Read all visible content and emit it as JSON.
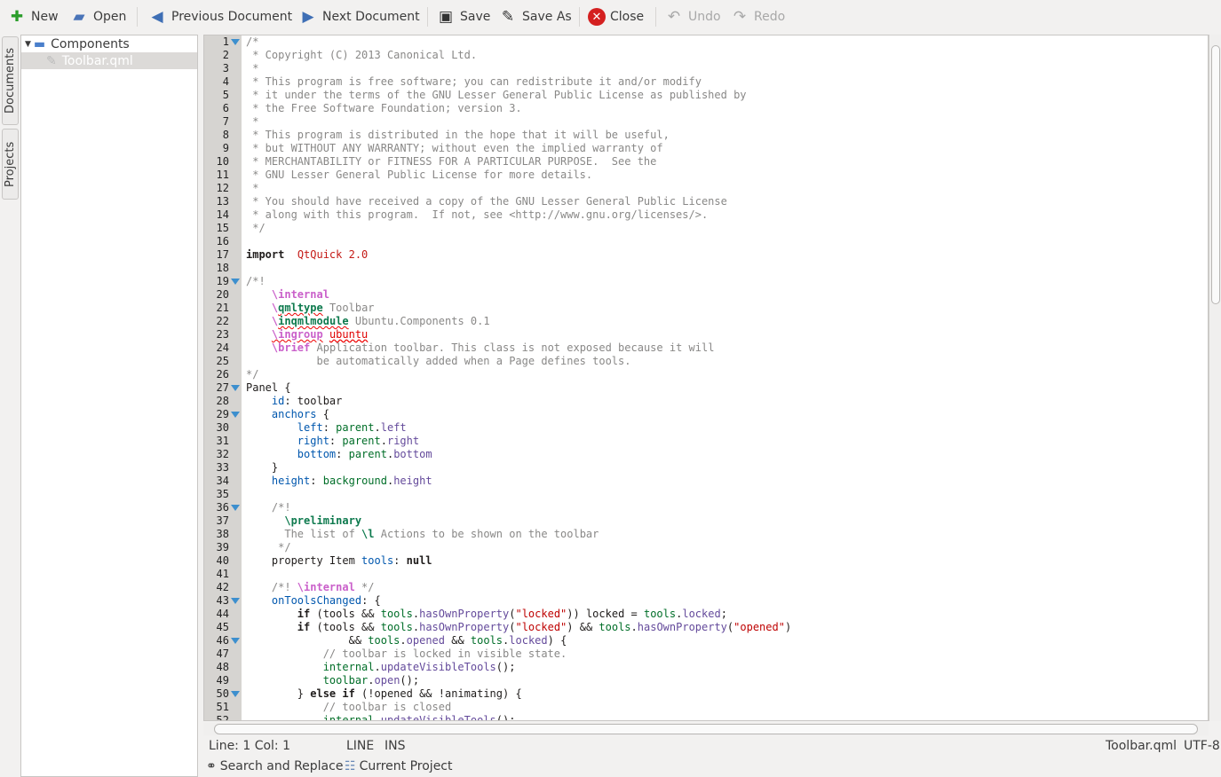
{
  "toolbar": {
    "items": [
      {
        "label": "New",
        "icon": "new-document-icon",
        "enabled": true
      },
      {
        "label": "Open",
        "icon": "open-folder-icon",
        "enabled": true
      },
      {
        "label": "Previous Document",
        "icon": "arrow-left-icon",
        "enabled": true
      },
      {
        "label": "Next Document",
        "icon": "arrow-right-icon",
        "enabled": true
      },
      {
        "label": "Save",
        "icon": "save-icon",
        "enabled": true
      },
      {
        "label": "Save As",
        "icon": "save-as-icon",
        "enabled": true
      },
      {
        "label": "Close",
        "icon": "close-icon",
        "enabled": true
      },
      {
        "label": "Undo",
        "icon": "undo-icon",
        "enabled": false
      },
      {
        "label": "Redo",
        "icon": "redo-icon",
        "enabled": false
      }
    ]
  },
  "side_tabs": {
    "documents": "Documents",
    "projects": "Projects"
  },
  "tree": {
    "folder": "Components",
    "file": "Toolbar.qml"
  },
  "editor": {
    "folds": [
      1,
      19,
      27,
      29,
      36,
      43,
      46,
      50
    ],
    "lines": [
      [
        [
          "c",
          "/*"
        ]
      ],
      [
        [
          "c",
          " * Copyright (C) 2013 Canonical Ltd."
        ]
      ],
      [
        [
          "c",
          " *"
        ]
      ],
      [
        [
          "c",
          " * This program is free software; you can redistribute it and/or modify"
        ]
      ],
      [
        [
          "c",
          " * it under the terms of the GNU Lesser General Public License as published by"
        ]
      ],
      [
        [
          "c",
          " * the Free Software Foundation; version 3."
        ]
      ],
      [
        [
          "c",
          " *"
        ]
      ],
      [
        [
          "c",
          " * This program is distributed in the hope that it will be useful,"
        ]
      ],
      [
        [
          "c",
          " * but WITHOUT ANY WARRANTY; without even the implied warranty of"
        ]
      ],
      [
        [
          "c",
          " * MERCHANTABILITY or FITNESS FOR A PARTICULAR PURPOSE.  See the"
        ]
      ],
      [
        [
          "c",
          " * GNU Lesser General Public License for more details."
        ]
      ],
      [
        [
          "c",
          " *"
        ]
      ],
      [
        [
          "c",
          " * You should have received a copy of the GNU Lesser General Public License"
        ]
      ],
      [
        [
          "c",
          " * along with this program.  If not, see <http://www.gnu.org/licenses/>."
        ]
      ],
      [
        [
          "c",
          " */"
        ]
      ],
      [],
      [
        [
          "k",
          "import"
        ],
        [
          "",
          "  "
        ],
        [
          "im",
          "QtQuick 2.0"
        ]
      ],
      [],
      [
        [
          "c",
          "/*!"
        ]
      ],
      [
        [
          "c",
          "    "
        ],
        [
          "dt",
          "\\internal"
        ]
      ],
      [
        [
          "c",
          "    "
        ],
        [
          "dt",
          "\\"
        ],
        [
          "dg u",
          "qmltype"
        ],
        [
          "c",
          " Toolbar"
        ]
      ],
      [
        [
          "c",
          "    "
        ],
        [
          "dt",
          "\\"
        ],
        [
          "dg u",
          "inqmlmodule"
        ],
        [
          "c",
          " Ubuntu.Components 0.1"
        ]
      ],
      [
        [
          "c",
          "    "
        ],
        [
          "dt u",
          "\\ingroup"
        ],
        [
          "c",
          " "
        ],
        [
          "q",
          "ubuntu"
        ]
      ],
      [
        [
          "c",
          "    "
        ],
        [
          "dt",
          "\\brief"
        ],
        [
          "c",
          " Application toolbar. This class is not exposed because it will"
        ]
      ],
      [
        [
          "c",
          "           be automatically added when a Page defines tools."
        ]
      ],
      [
        [
          "c",
          "*/"
        ]
      ],
      [
        [
          "",
          "Panel {"
        ]
      ],
      [
        [
          "",
          "    "
        ],
        [
          "p",
          "id"
        ],
        [
          "",
          ": toolbar"
        ]
      ],
      [
        [
          "",
          "    "
        ],
        [
          "p",
          "anchors"
        ],
        [
          "",
          " {"
        ]
      ],
      [
        [
          "",
          "        "
        ],
        [
          "p",
          "left"
        ],
        [
          "",
          ": "
        ],
        [
          "o",
          "parent"
        ],
        [
          "",
          "."
        ],
        [
          "m",
          "left"
        ]
      ],
      [
        [
          "",
          "        "
        ],
        [
          "p",
          "right"
        ],
        [
          "",
          ": "
        ],
        [
          "o",
          "parent"
        ],
        [
          "",
          "."
        ],
        [
          "m",
          "right"
        ]
      ],
      [
        [
          "",
          "        "
        ],
        [
          "p",
          "bottom"
        ],
        [
          "",
          ": "
        ],
        [
          "o",
          "parent"
        ],
        [
          "",
          "."
        ],
        [
          "m",
          "bottom"
        ]
      ],
      [
        [
          "",
          "    }"
        ]
      ],
      [
        [
          "",
          "    "
        ],
        [
          "p",
          "height"
        ],
        [
          "",
          ": "
        ],
        [
          "o",
          "background"
        ],
        [
          "",
          "."
        ],
        [
          "m",
          "height"
        ]
      ],
      [],
      [
        [
          "c",
          "    /*!"
        ]
      ],
      [
        [
          "c",
          "      "
        ],
        [
          "dg",
          "\\preliminary"
        ]
      ],
      [
        [
          "c",
          "      The list of "
        ],
        [
          "dg",
          "\\l"
        ],
        [
          "c",
          " Actions to be shown on the toolbar"
        ]
      ],
      [
        [
          "c",
          "     */"
        ]
      ],
      [
        [
          "",
          "    property Item "
        ],
        [
          "p",
          "tools"
        ],
        [
          "",
          ": "
        ],
        [
          "k",
          "null"
        ]
      ],
      [],
      [
        [
          "c",
          "    /*! "
        ],
        [
          "dt",
          "\\internal"
        ],
        [
          "c",
          " */"
        ]
      ],
      [
        [
          "",
          "    "
        ],
        [
          "p",
          "onToolsChanged"
        ],
        [
          "",
          ": {"
        ]
      ],
      [
        [
          "",
          "        "
        ],
        [
          "k",
          "if"
        ],
        [
          "",
          " (tools && "
        ],
        [
          "o",
          "tools"
        ],
        [
          "",
          "."
        ],
        [
          "m",
          "hasOwnProperty"
        ],
        [
          "",
          "("
        ],
        [
          "s",
          "\"locked\""
        ],
        [
          "",
          "))"
        ],
        [
          "",
          " locked = "
        ],
        [
          "o",
          "tools"
        ],
        [
          "",
          "."
        ],
        [
          "m",
          "locked"
        ],
        [
          "",
          ";"
        ]
      ],
      [
        [
          "",
          "        "
        ],
        [
          "k",
          "if"
        ],
        [
          "",
          " (tools && "
        ],
        [
          "o",
          "tools"
        ],
        [
          "",
          "."
        ],
        [
          "m",
          "hasOwnProperty"
        ],
        [
          "",
          "("
        ],
        [
          "s",
          "\"locked\""
        ],
        [
          "",
          ") && "
        ],
        [
          "o",
          "tools"
        ],
        [
          "",
          "."
        ],
        [
          "m",
          "hasOwnProperty"
        ],
        [
          "",
          "("
        ],
        [
          "s",
          "\"opened\""
        ],
        [
          "",
          ")"
        ]
      ],
      [
        [
          "",
          "                && "
        ],
        [
          "o",
          "tools"
        ],
        [
          "",
          "."
        ],
        [
          "m",
          "opened"
        ],
        [
          "",
          " && "
        ],
        [
          "o",
          "tools"
        ],
        [
          "",
          "."
        ],
        [
          "m",
          "locked"
        ],
        [
          "",
          ") {"
        ]
      ],
      [
        [
          "c",
          "            // toolbar is locked in visible state."
        ]
      ],
      [
        [
          "",
          "            "
        ],
        [
          "o",
          "internal"
        ],
        [
          "",
          "."
        ],
        [
          "m",
          "updateVisibleTools"
        ],
        [
          "",
          "();"
        ]
      ],
      [
        [
          "",
          "            "
        ],
        [
          "o",
          "toolbar"
        ],
        [
          "",
          "."
        ],
        [
          "m",
          "open"
        ],
        [
          "",
          "();"
        ]
      ],
      [
        [
          "",
          "        } "
        ],
        [
          "k",
          "else if"
        ],
        [
          "",
          " (!opened && !animating) {"
        ]
      ],
      [
        [
          "c",
          "            // toolbar is closed"
        ]
      ],
      [
        [
          "",
          "            "
        ],
        [
          "o",
          "internal"
        ],
        [
          "",
          "."
        ],
        [
          "m",
          "updateVisibleTools"
        ],
        [
          "",
          "();"
        ]
      ]
    ]
  },
  "status": {
    "position": "Line: 1 Col: 1",
    "mode": "LINE",
    "insert": "INS",
    "filename": "Toolbar.qml",
    "encoding": "UTF-8"
  },
  "bottom": {
    "search": "Search and Replace",
    "project": "Current Project"
  },
  "colors": {
    "gutter": "#d6d4d1",
    "fold_marker": "#3d8fce",
    "comment": "#898887",
    "string": "#bf0303"
  }
}
